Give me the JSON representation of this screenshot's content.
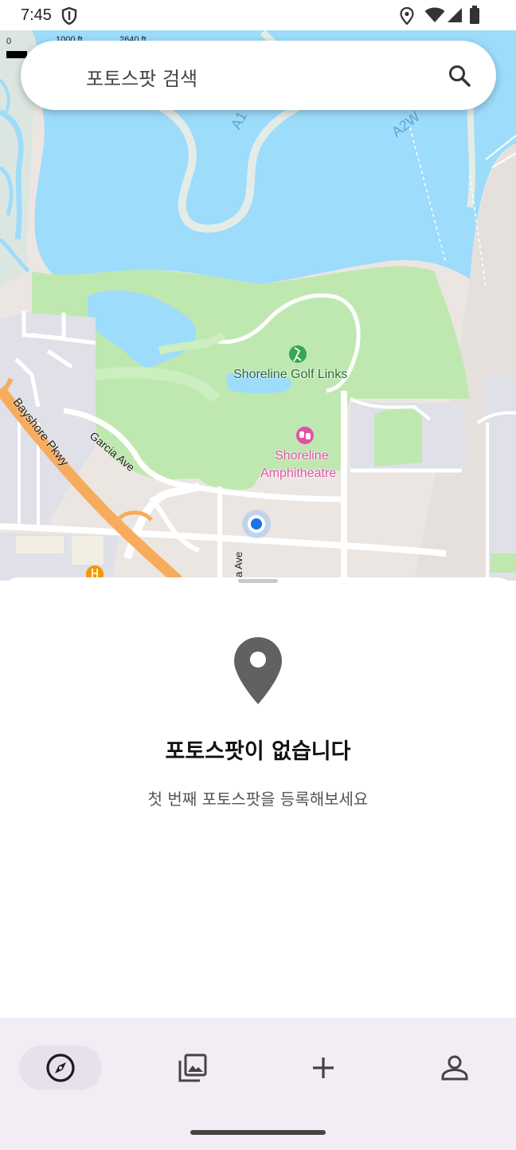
{
  "status_bar": {
    "time": "7:45"
  },
  "map": {
    "scale_zero": "0",
    "scale_mid": "1000 ft",
    "scale_end": "2640 ft",
    "labels": {
      "golf": "Shoreline Golf Links",
      "amphi_line1": "Shoreline",
      "amphi_line2": "Amphitheatre",
      "bayshore": "Bayshore Pkwy",
      "garcia": "Garcia Ave",
      "a2w": "A2W",
      "a1": "A1",
      "road_fragment": "a Ave"
    }
  },
  "search": {
    "placeholder": "포토스팟 검색"
  },
  "empty_state": {
    "title": "포토스팟이 없습니다",
    "subtitle": "첫 번째 포토스팟을 등록해보세요"
  },
  "colors": {
    "water": "#9ddcfb",
    "park": "#bfe8b0",
    "highway": "#f7ac5d",
    "amphitheatre_label": "#e052a8",
    "golf_label": "#2b6a2b",
    "location_dot": "#1a73e8",
    "nav_bg": "#f2ecf5"
  },
  "nav": {
    "items": [
      {
        "icon": "explore-icon",
        "active": true
      },
      {
        "icon": "photo-library-icon",
        "active": false
      },
      {
        "icon": "add-icon",
        "active": false
      },
      {
        "icon": "person-icon",
        "active": false
      }
    ]
  }
}
